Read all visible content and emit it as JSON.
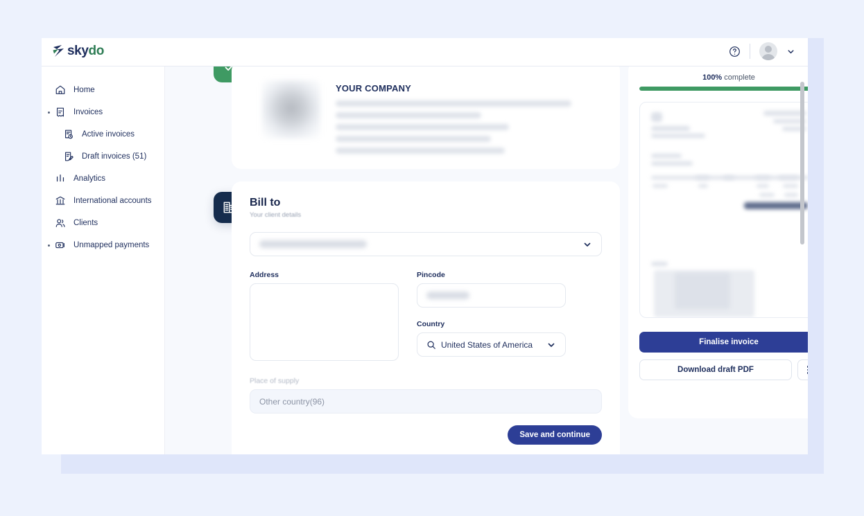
{
  "brand": {
    "name_part1": "sky",
    "name_part2": "do",
    "logo_icon": "skydo-logo-icon"
  },
  "topbar": {
    "help_icon": "help-circle-icon",
    "avatar_icon": "user-avatar-icon",
    "chevron_icon": "chevron-down-icon"
  },
  "sidebar": {
    "items": [
      {
        "label": "Home",
        "icon": "home-icon",
        "sub": false,
        "expandable": false
      },
      {
        "label": "Invoices",
        "icon": "invoice-icon",
        "sub": false,
        "expandable": true
      },
      {
        "label": "Active invoices",
        "icon": "active-invoice-icon",
        "sub": true,
        "expandable": false
      },
      {
        "label": "Draft invoices (51)",
        "icon": "draft-invoice-icon",
        "sub": true,
        "expandable": false
      },
      {
        "label": "Analytics",
        "icon": "analytics-bars-icon",
        "sub": false,
        "expandable": false
      },
      {
        "label": "International accounts",
        "icon": "bank-icon",
        "sub": false,
        "expandable": false
      },
      {
        "label": "Clients",
        "icon": "people-icon",
        "sub": false,
        "expandable": false
      },
      {
        "label": "Unmapped payments",
        "icon": "cash-icon",
        "sub": false,
        "expandable": true
      }
    ]
  },
  "steps": {
    "completed_icon": "check-step-icon",
    "active_icon": "building-step-icon"
  },
  "company_card": {
    "title": "YOUR COMPANY",
    "logo": "company-logo-image",
    "detail_lines_redacted": 5
  },
  "bill_to": {
    "title": "Bill to",
    "subtitle": "Your client details",
    "client_select": {
      "value_redacted": true,
      "chevron_icon": "chevron-down-icon"
    },
    "address": {
      "label": "Address",
      "value": "",
      "placeholder": ""
    },
    "pincode": {
      "label": "Pincode",
      "value_redacted": true,
      "placeholder": ""
    },
    "country": {
      "label": "Country",
      "value": "United States of America",
      "search_icon": "search-icon",
      "chevron_icon": "chevron-down-icon"
    },
    "place_of_supply": {
      "label": "Place of supply",
      "value": "Other country(96)"
    },
    "save_button": "Save and continue"
  },
  "preview": {
    "progress_percent": "100%",
    "progress_suffix": " complete",
    "progress_value": 100,
    "thumbnail": "invoice-preview-thumbnail",
    "finalise_button": "Finalise invoice",
    "download_button": "Download draft PDF",
    "more_icon": "more-vertical-icon"
  },
  "colors": {
    "brand_navy": "#1d2d5c",
    "brand_green": "#2f7d55",
    "primary_button": "#2d3e96",
    "progress_green": "#3f9a63",
    "step_done": "#3f9a63",
    "step_active": "#152c4d",
    "page_bg": "#edf2fd",
    "content_bg": "#f7f9fd"
  }
}
